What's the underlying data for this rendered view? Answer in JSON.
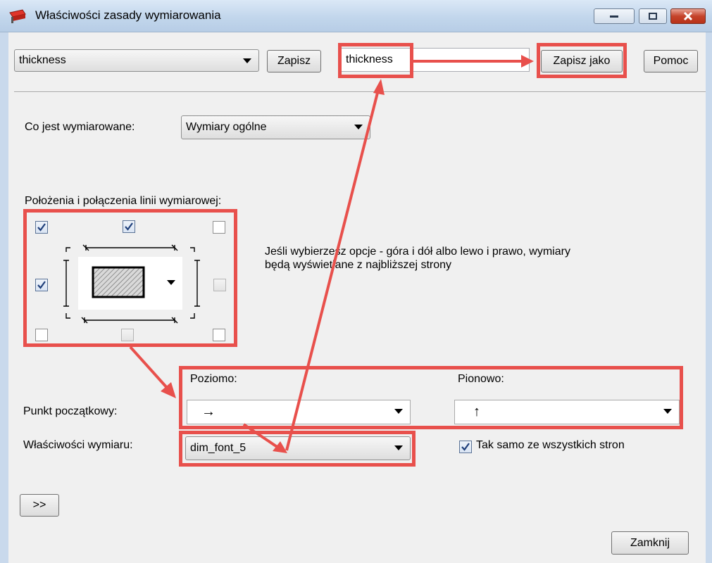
{
  "window": {
    "title": "Właściwości zasady wymiarowania",
    "accent_color": "#e8504c"
  },
  "toolbar": {
    "rule_select_value": "thickness",
    "save_label": "Zapisz",
    "save_as_input_value": "thickness",
    "save_as_label": "Zapisz jako",
    "help_label": "Pomoc"
  },
  "measured": {
    "label": "Co jest wymiarowane:",
    "value": "Wymiary ogólne"
  },
  "positions": {
    "label": "Położenia i połączenia linii wymiarowej:",
    "checkboxes": {
      "top_left": true,
      "top_middle": true,
      "top_right": false,
      "middle_left": true,
      "middle_right": false,
      "bottom_left": false,
      "bottom_middle": false,
      "bottom_right": false
    },
    "info_text": "Jeśli wybierzesz opcje - góra i dół albo lewo i prawo, wymiary będą wyświetlane z najbliższej strony"
  },
  "start_point": {
    "label": "Punkt początkowy:",
    "horizontal_label": "Poziomo:",
    "horizontal_value": "→",
    "vertical_label": "Pionowo:",
    "vertical_value": "↑"
  },
  "dimension_props": {
    "label": "Właściwości wymiaru:",
    "value": "dim_font_5",
    "same_all_sides_label": "Tak samo ze wszystkich stron",
    "same_all_sides_checked": true
  },
  "expand_label": ">>",
  "close_label": "Zamknij"
}
